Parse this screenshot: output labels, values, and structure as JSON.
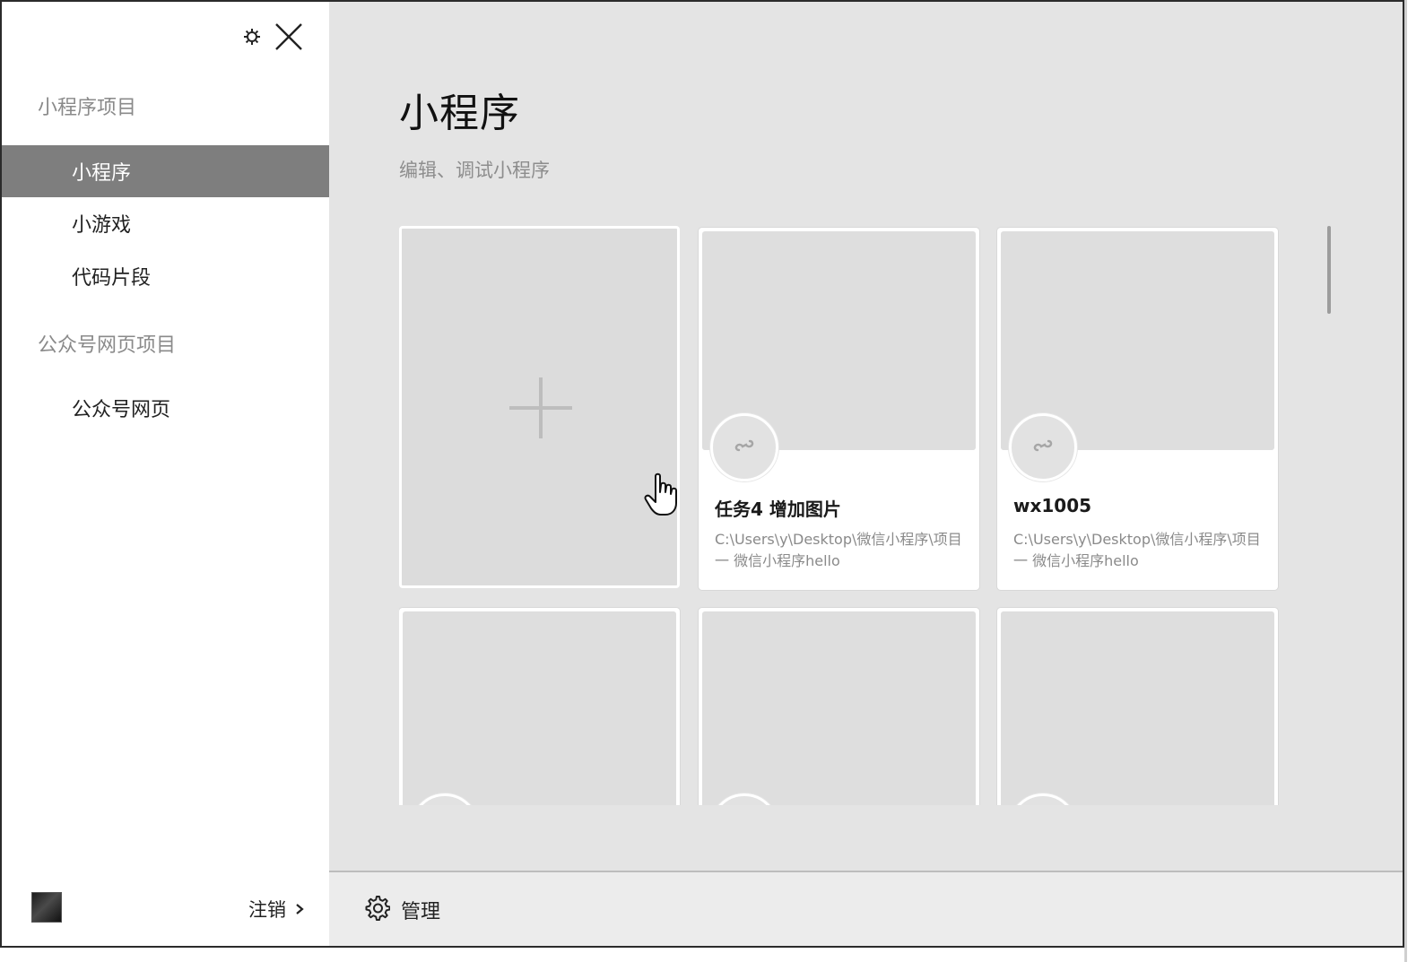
{
  "sidebar": {
    "section_miniprogram": "小程序项目",
    "items": [
      {
        "label": "小程序",
        "active": true
      },
      {
        "label": "小游戏",
        "active": false
      },
      {
        "label": "代码片段",
        "active": false
      }
    ],
    "section_official": "公众号网页项目",
    "official_items": [
      {
        "label": "公众号网页"
      }
    ],
    "logout_label": "注销",
    "logout_arrow": "›"
  },
  "main": {
    "title": "小程序",
    "subtitle": "编辑、调试小程序",
    "projects": [
      {
        "name": "任务4 增加图片",
        "path": "C:\\Users\\y\\Desktop\\微信小程序\\项目一 微信小程序hello"
      },
      {
        "name": "wx1005",
        "path": "C:\\Users\\y\\Desktop\\微信小程序\\项目一 微信小程序hello"
      }
    ]
  },
  "bottom_bar": {
    "manage_label": "管理"
  },
  "colors": {
    "sidebar_active_bg": "#7e7e7e",
    "main_bg": "#e4e4e4",
    "card_bg": "#ffffff",
    "thumb_bg": "#dedede"
  },
  "icons": [
    "settings-icon",
    "close-icon",
    "plus-icon",
    "link-icon",
    "hand-cursor-icon",
    "gear-icon",
    "chevron-right-icon"
  ]
}
